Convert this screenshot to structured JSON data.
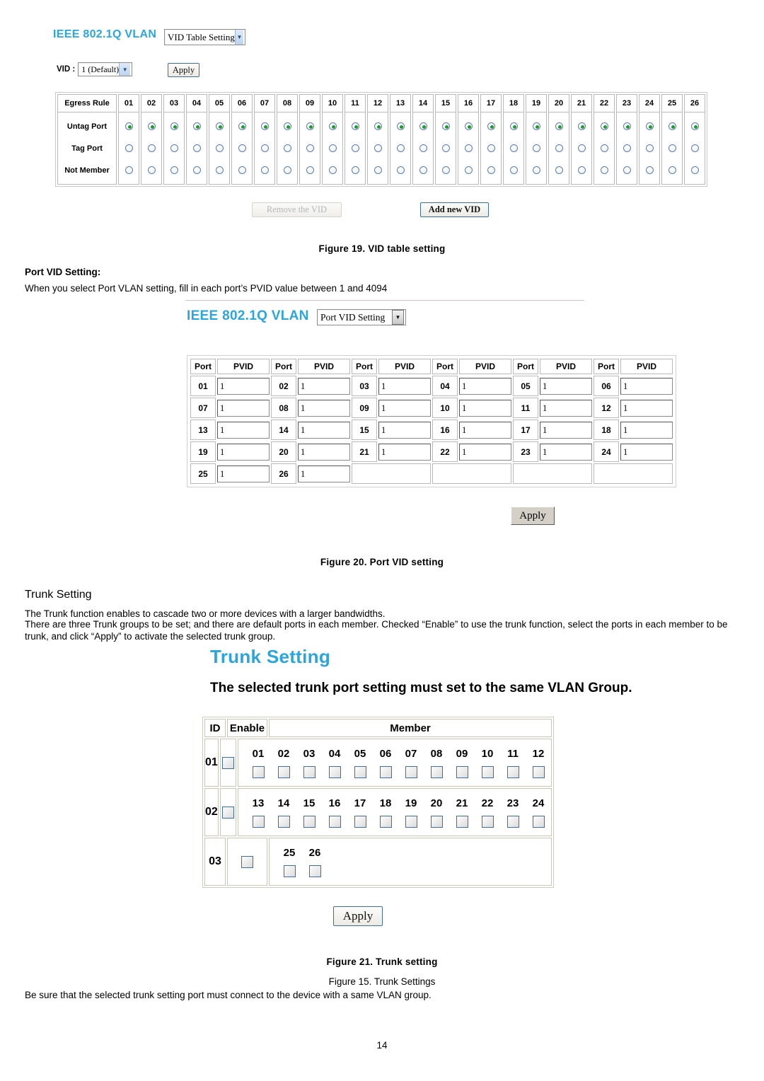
{
  "fig19": {
    "ui_title": "IEEE 802.1Q VLAN",
    "mode_select": {
      "value": "VID Table Setting",
      "arrow_icon": "chevron-down-icon"
    },
    "vid_label": "VID :",
    "vid_select": {
      "value": "1  (Default)",
      "arrow_icon": "chevron-down-icon"
    },
    "apply_label": "Apply",
    "table": {
      "corner_header": "Egress Rule",
      "row_labels": [
        "Untag Port",
        "Tag Port",
        "Not Member"
      ],
      "ports": [
        "01",
        "02",
        "03",
        "04",
        "05",
        "06",
        "07",
        "08",
        "09",
        "10",
        "11",
        "12",
        "13",
        "14",
        "15",
        "16",
        "17",
        "18",
        "19",
        "20",
        "21",
        "22",
        "23",
        "24",
        "25",
        "26"
      ],
      "selected_row_index": 0
    },
    "remove_button": "Remove the VID",
    "remove_button_disabled": true,
    "add_button": "Add new VID",
    "caption": "Figure 19. VID table setting"
  },
  "port_vid_section": {
    "heading": "Port VID Setting:",
    "description": "When you select Port VLAN setting, fill in each port’s PVID value between 1 and 4094"
  },
  "fig20": {
    "ui_title": "IEEE 802.1Q VLAN",
    "mode_select": {
      "value": "Port VID Setting",
      "arrow_icon": "chevron-down-icon"
    },
    "table": {
      "headers": [
        "Port",
        "PVID"
      ],
      "column_pairs": 6,
      "rows": [
        [
          {
            "port": "01",
            "pvid": "1"
          },
          {
            "port": "02",
            "pvid": "1"
          },
          {
            "port": "03",
            "pvid": "1"
          },
          {
            "port": "04",
            "pvid": "1"
          },
          {
            "port": "05",
            "pvid": "1"
          },
          {
            "port": "06",
            "pvid": "1"
          }
        ],
        [
          {
            "port": "07",
            "pvid": "1"
          },
          {
            "port": "08",
            "pvid": "1"
          },
          {
            "port": "09",
            "pvid": "1"
          },
          {
            "port": "10",
            "pvid": "1"
          },
          {
            "port": "11",
            "pvid": "1"
          },
          {
            "port": "12",
            "pvid": "1"
          }
        ],
        [
          {
            "port": "13",
            "pvid": "1"
          },
          {
            "port": "14",
            "pvid": "1"
          },
          {
            "port": "15",
            "pvid": "1"
          },
          {
            "port": "16",
            "pvid": "1"
          },
          {
            "port": "17",
            "pvid": "1"
          },
          {
            "port": "18",
            "pvid": "1"
          }
        ],
        [
          {
            "port": "19",
            "pvid": "1"
          },
          {
            "port": "20",
            "pvid": "1"
          },
          {
            "port": "21",
            "pvid": "1"
          },
          {
            "port": "22",
            "pvid": "1"
          },
          {
            "port": "23",
            "pvid": "1"
          },
          {
            "port": "24",
            "pvid": "1"
          }
        ],
        [
          {
            "port": "25",
            "pvid": "1"
          },
          {
            "port": "26",
            "pvid": "1"
          },
          null,
          null,
          null,
          null
        ]
      ]
    },
    "apply_label": "Apply",
    "caption": "Figure 20. Port VID setting"
  },
  "trunk_section": {
    "heading": "Trunk Setting",
    "para1": "The Trunk function enables to cascade two or more devices with a larger bandwidths.",
    "para2": "There are three Trunk groups to be set; and there are default ports in each member. Checked “Enable” to use the trunk function, select the ports in each member to be trunk, and click “Apply” to activate the selected trunk group."
  },
  "fig21": {
    "ui_title": "Trunk Setting",
    "notice": "The selected trunk port setting must set to the same VLAN Group.",
    "table": {
      "headers": [
        "ID",
        "Enable",
        "Member"
      ],
      "rows": [
        {
          "id": "01",
          "enabled": false,
          "members": [
            "01",
            "02",
            "03",
            "04",
            "05",
            "06",
            "07",
            "08",
            "09",
            "10",
            "11",
            "12"
          ]
        },
        {
          "id": "02",
          "enabled": false,
          "members": [
            "13",
            "14",
            "15",
            "16",
            "17",
            "18",
            "19",
            "20",
            "21",
            "22",
            "23",
            "24"
          ]
        },
        {
          "id": "03",
          "enabled": false,
          "members": [
            "25",
            "26"
          ]
        }
      ]
    },
    "apply_label": "Apply",
    "caption": "Figure 21. Trunk setting",
    "caption_alt": "Figure 15. Trunk Settings"
  },
  "trunk_note": "Be sure that the selected trunk setting port must connect to the device with a same VLAN group.",
  "page_number": "14",
  "colors": {
    "ui_title_blue": "#2aa5de",
    "radio_checked_green": "#1c9c2a",
    "checkbox_border_blue": "#3f6ea0"
  }
}
